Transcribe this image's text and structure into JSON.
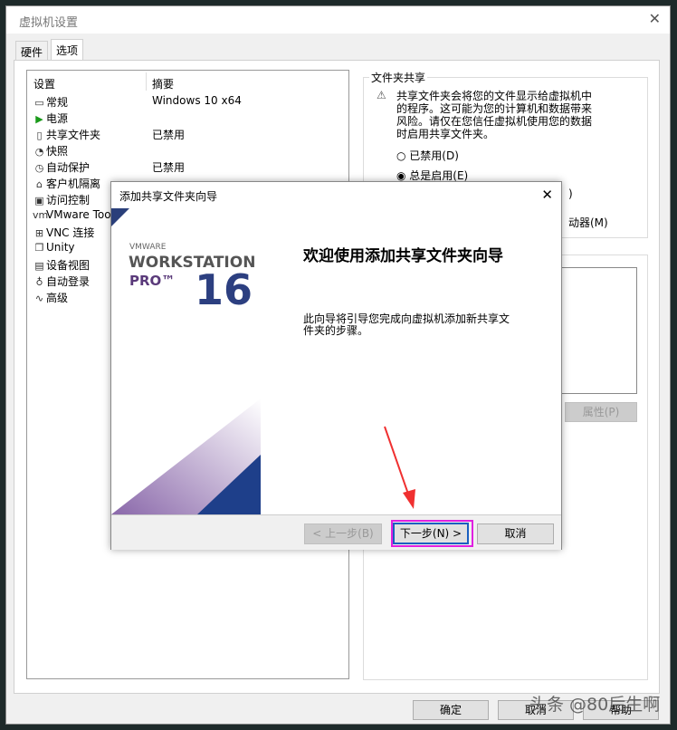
{
  "window": {
    "title": "虚拟机设置",
    "close_icon": "close-icon"
  },
  "tabs": [
    {
      "label": "硬件"
    },
    {
      "label": "选项",
      "active": true
    }
  ],
  "list": {
    "headers": [
      "设置",
      "摘要"
    ],
    "items": [
      {
        "icon": "monitor-icon",
        "glyph": "▭",
        "label": "常规",
        "summary": "Windows 10 x64"
      },
      {
        "icon": "play-icon",
        "glyph": "▶",
        "label": "电源",
        "summary": ""
      },
      {
        "icon": "shared-folder-icon",
        "glyph": "▯",
        "label": "共享文件夹",
        "summary": "已禁用"
      },
      {
        "icon": "snapshot-icon",
        "glyph": "◔",
        "label": "快照",
        "summary": ""
      },
      {
        "icon": "clock-icon",
        "glyph": "◷",
        "label": "自动保护",
        "summary": "已禁用"
      },
      {
        "icon": "lock-icon",
        "glyph": "⌂",
        "label": "客户机隔离",
        "summary": ""
      },
      {
        "icon": "access-control-icon",
        "glyph": "▣",
        "label": "访问控制",
        "summary": ""
      },
      {
        "icon": "vmware-tools-icon",
        "glyph": "vm",
        "label": "VMware Too",
        "summary": ""
      },
      {
        "icon": "vnc-icon",
        "glyph": "⊞",
        "label": "VNC 连接",
        "summary": ""
      },
      {
        "icon": "unity-icon",
        "glyph": "❐",
        "label": "Unity",
        "summary": ""
      },
      {
        "icon": "device-view-icon",
        "glyph": "▤",
        "label": "设备视图",
        "summary": ""
      },
      {
        "icon": "autologin-icon",
        "glyph": "♁",
        "label": "自动登录",
        "summary": ""
      },
      {
        "icon": "advanced-icon",
        "glyph": "∿",
        "label": "高级",
        "summary": ""
      }
    ]
  },
  "folder_sharing": {
    "title": "文件夹共享",
    "warning_icon": "warning-icon",
    "warning": [
      "共享文件夹会将您的文件显示给虚拟机中",
      "的程序。这可能为您的计算机和数据带来",
      "风险。请仅在您信任虚拟机使用您的数据",
      "时启用共享文件夹。"
    ],
    "options": [
      {
        "label": "已禁用(D)",
        "checked": false
      },
      {
        "label": "总是启用(E)",
        "checked": true
      }
    ],
    "hidden_partial_1": ")",
    "hidden_partial_2": "动器(M)"
  },
  "folders": {
    "properties_button": "属性(P)"
  },
  "footer": {
    "ok": "确定",
    "cancel": "取消",
    "help": "帮助"
  },
  "watermark": "头条 @80后生啊",
  "wizard": {
    "title": "添加共享文件夹向导",
    "logo": {
      "brand": "VMWARE",
      "product": "WORKSTATION",
      "edition": "PRO™",
      "version": "16"
    },
    "heading": "欢迎使用添加共享文件夹向导",
    "description": [
      "此向导将引导您完成向虚拟机添加新共享文",
      "件夹的步骤。"
    ],
    "back": "< 上一步(B)",
    "next": "下一步(N) >",
    "cancel": "取消"
  },
  "colors": {
    "highlight": "#e020e0",
    "arrow": "#f03030",
    "brand_blue": "#1e3f8a",
    "brand_purple": "#5a3a7a"
  }
}
